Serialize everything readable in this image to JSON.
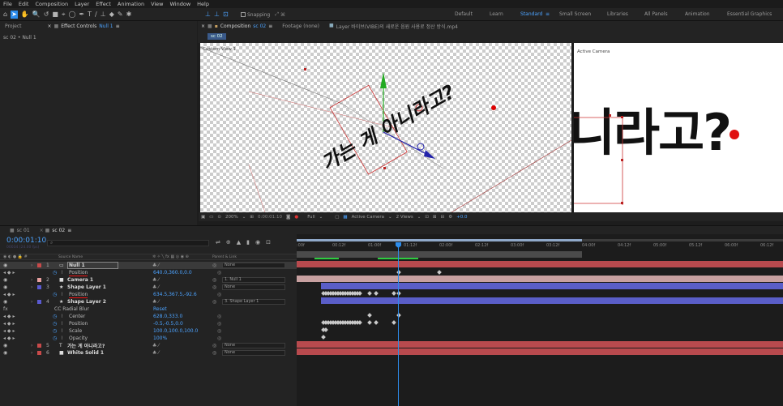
{
  "menu": [
    "File",
    "Edit",
    "Composition",
    "Layer",
    "Effect",
    "Animation",
    "View",
    "Window",
    "Help"
  ],
  "toolbar": {
    "snapping_label": "Snapping"
  },
  "workspaces": [
    "Default",
    "Learn",
    "Standard",
    "Small Screen",
    "Libraries",
    "All Panels",
    "Animation",
    "Essential Graphics"
  ],
  "active_workspace": "Standard",
  "left_panel": {
    "tab_project": "Project",
    "tab_effect_controls": "Effect Controls",
    "effect_target": "Null 1",
    "breadcrumb": "sc 02 • Null 1"
  },
  "comp_panel": {
    "tab_composition": "Composition",
    "comp_name": "sc 02",
    "tab_footage": "Footage  (none)",
    "tab_layer": "Layer  바이브(VIBE)의 새로운 음원 사용로 정산 방식.mp4",
    "subtab": "sc 02"
  },
  "viewer": {
    "left_view_label": "Custom View 1",
    "right_view_label": "Active Camera",
    "left_text": "가는 게 아니라고?",
    "right_text": "니라고?"
  },
  "viewer_bar": {
    "zoom": "200%",
    "timecode": "0:00:01:10",
    "resolution": "Full",
    "camera": "Active Camera",
    "views": "2 Views",
    "exposure": "+0.0"
  },
  "timeline_tabs": [
    {
      "label": "sc 01",
      "active": false
    },
    {
      "label": "sc 02",
      "active": true
    }
  ],
  "timeline": {
    "current_time": "0:00:01:10",
    "frame_info": "00034 (24.00 fps)",
    "search_placeholder": "",
    "col_source": "Source Name",
    "col_parent": "Parent & Link",
    "ruler": [
      ":00f",
      "00:12f",
      "01:00f",
      "01:12f",
      "02:00f",
      "02:12f",
      "03:00f",
      "03:12f",
      "04:00f",
      "04:12f",
      "05:00f",
      "05:12f",
      "06:00f",
      "06:12f"
    ],
    "layers": [
      {
        "num": "1",
        "name": "Null 1",
        "type": "null",
        "color": "#c84a4a",
        "parent": "None",
        "selected": true
      },
      {
        "prop": "Position",
        "value": "640.0,360.0,0.0",
        "underline": true
      },
      {
        "num": "2",
        "name": "Camera 1",
        "type": "camera",
        "color": "#e8a0a0",
        "parent": "1. Null 1"
      },
      {
        "num": "3",
        "name": "Shape Layer 1",
        "type": "shape",
        "color": "#5a5ad0",
        "parent": "None"
      },
      {
        "prop": "Position",
        "value": "634.5,367.5,-92.6",
        "underline": true
      },
      {
        "num": "4",
        "name": "Shape Layer 2",
        "type": "shape",
        "color": "#5a5ad0",
        "parent": "3. Shape Layer 1"
      },
      {
        "effect": "CC Radial Blur",
        "value": "Reset"
      },
      {
        "prop": "Center",
        "value": "628.0,333.0"
      },
      {
        "prop": "Position",
        "value": "-0.5,-0.5,0.0"
      },
      {
        "prop": "Scale",
        "value": "100.0,100.0,100.0"
      },
      {
        "prop": "Opacity",
        "value": "100%"
      },
      {
        "num": "5",
        "name": "가는 게 아니라고?",
        "type": "text",
        "color": "#c84a4a",
        "parent": "None"
      },
      {
        "num": "6",
        "name": "White Solid 1",
        "type": "solid",
        "color": "#c84a4a",
        "parent": "None"
      }
    ]
  },
  "colors": {
    "accent": "#4ca3ff",
    "layer_red": "#b84a4e",
    "layer_blue": "#5a5ec8",
    "playhead": "#2d8ceb"
  }
}
